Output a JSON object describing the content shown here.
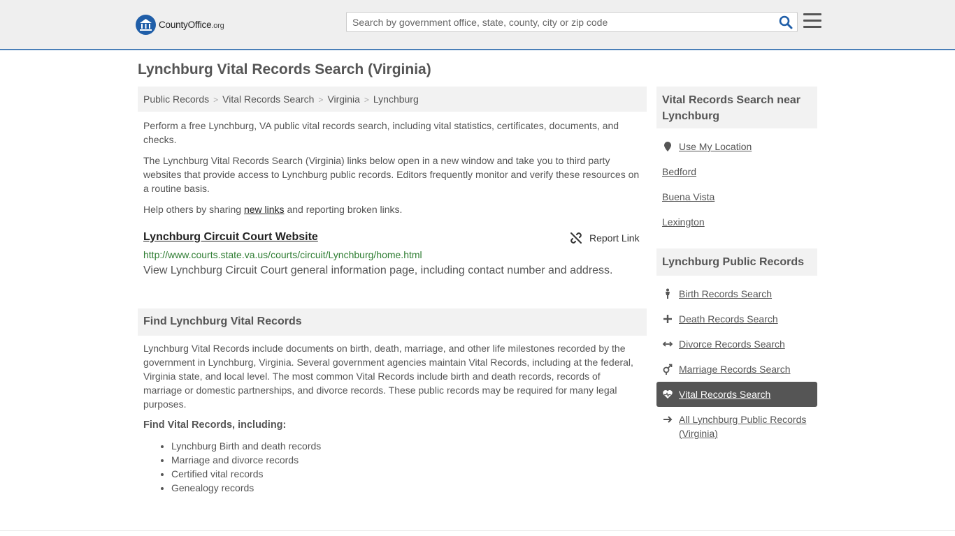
{
  "header": {
    "logo_text": "CountyOffice",
    "logo_suffix": ".org",
    "search_placeholder": "Search by government office, state, county, city or zip code"
  },
  "page": {
    "title": "Lynchburg Vital Records Search (Virginia)"
  },
  "breadcrumb": [
    "Public Records",
    "Vital Records Search",
    "Virginia",
    "Lynchburg"
  ],
  "intro": {
    "p1": "Perform a free Lynchburg, VA public vital records search, including vital statistics, certificates, documents, and checks.",
    "p2": "The Lynchburg Vital Records Search (Virginia) links below open in a new window and take you to third party websites that provide access to Lynchburg public records. Editors frequently monitor and verify these resources on a routine basis.",
    "p3_before": "Help others by sharing ",
    "p3_link": "new links",
    "p3_after": " and reporting broken links."
  },
  "resource": {
    "title": "Lynchburg Circuit Court Website",
    "report_label": "Report Link",
    "url": "http://www.courts.state.va.us/courts/circuit/Lynchburg/home.html",
    "description": "View Lynchburg Circuit Court general information page, including contact number and address."
  },
  "find_section": {
    "heading": "Find Lynchburg Vital Records",
    "body": "Lynchburg Vital Records include documents on birth, death, marriage, and other life milestones recorded by the government in Lynchburg, Virginia. Several government agencies maintain Vital Records, including at the federal, Virginia state, and local level. The most common Vital Records include birth and death records, records of marriage or domestic partnerships, and divorce records. These public records may be required for many legal purposes.",
    "subheading": "Find Vital Records, including:",
    "bullets": [
      "Lynchburg Birth and death records",
      "Marriage and divorce records",
      "Certified vital records",
      "Genealogy records"
    ]
  },
  "sidebar": {
    "near_heading": "Vital Records Search near Lynchburg",
    "use_location": "Use My Location",
    "nearby": [
      "Bedford",
      "Buena Vista",
      "Lexington"
    ],
    "public_heading": "Lynchburg Public Records",
    "links": [
      {
        "label": "Birth Records Search",
        "icon": "person-icon"
      },
      {
        "label": "Death Records Search",
        "icon": "cross-icon"
      },
      {
        "label": "Divorce Records Search",
        "icon": "arrows-horizontal-icon"
      },
      {
        "label": "Marriage Records Search",
        "icon": "gender-icon"
      },
      {
        "label": "Vital Records Search",
        "icon": "heartbeat-icon",
        "active": true
      },
      {
        "label": "All Lynchburg Public Records (Virginia)",
        "icon": "arrow-right-icon"
      }
    ]
  },
  "colors": {
    "brand_blue": "#1f5ea8",
    "header_border": "#4a7fb8",
    "url_green": "#2e7d32",
    "active_bg": "#555555"
  }
}
